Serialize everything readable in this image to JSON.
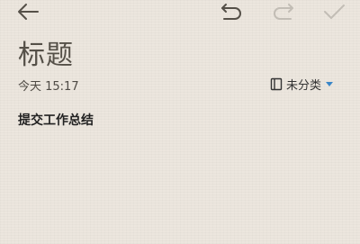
{
  "toolbar": {
    "icons": [
      "back-arrow-icon",
      "undo-icon",
      "redo-icon",
      "checkmark-icon"
    ]
  },
  "note": {
    "title": "标题",
    "date": "今天 15:17",
    "category": "未分类",
    "body": "提交工作总结"
  },
  "colors": {
    "background": "#ece6dd",
    "icon_active": "#555048",
    "icon_disabled": "#c2bdb5",
    "accent": "#3a86c8"
  }
}
